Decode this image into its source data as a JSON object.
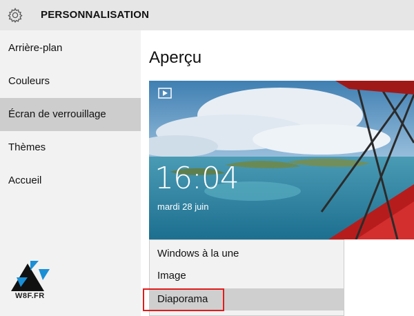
{
  "header": {
    "title": "PERSONNALISATION",
    "icon": "gear-icon"
  },
  "sidebar": {
    "items": [
      {
        "label": "Arrière-plan"
      },
      {
        "label": "Couleurs"
      },
      {
        "label": "Écran de verrouillage",
        "selected": true
      },
      {
        "label": "Thèmes"
      },
      {
        "label": "Accueil"
      }
    ],
    "logo_text": "W8F.FR"
  },
  "main": {
    "section_title": "Aperçu",
    "preview": {
      "time": "16:04",
      "date": "mardi 28 juin",
      "icon": "slideshow-icon"
    },
    "dropdown": {
      "options": [
        {
          "label": "Windows à la une"
        },
        {
          "label": "Image"
        },
        {
          "label": "Diaporama",
          "selected": true
        }
      ]
    }
  },
  "colors": {
    "accent_highlight": "#e21b1b",
    "selected_bg": "#cdcdcd",
    "sidebar_bg": "#f2f2f2",
    "titlebar_bg": "#e6e6e6"
  }
}
